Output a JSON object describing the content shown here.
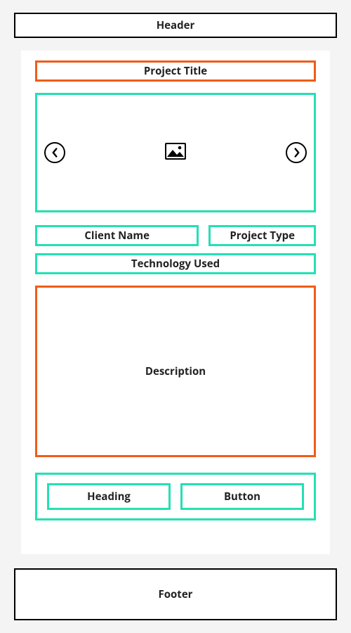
{
  "header": {
    "label": "Header"
  },
  "footer": {
    "label": "Footer"
  },
  "project": {
    "title_label": "Project Title",
    "client_name_label": "Client Name",
    "project_type_label": "Project Type",
    "technology_used_label": "Technology Used",
    "description_label": "Description"
  },
  "carousel": {
    "image_placeholder_name": "image-placeholder",
    "prev_label": "previous",
    "next_label": "next"
  },
  "cta": {
    "heading_label": "Heading",
    "button_label": "Button"
  },
  "colors": {
    "orange": "#f05c18",
    "teal": "#23e0b4",
    "black": "#000000"
  }
}
